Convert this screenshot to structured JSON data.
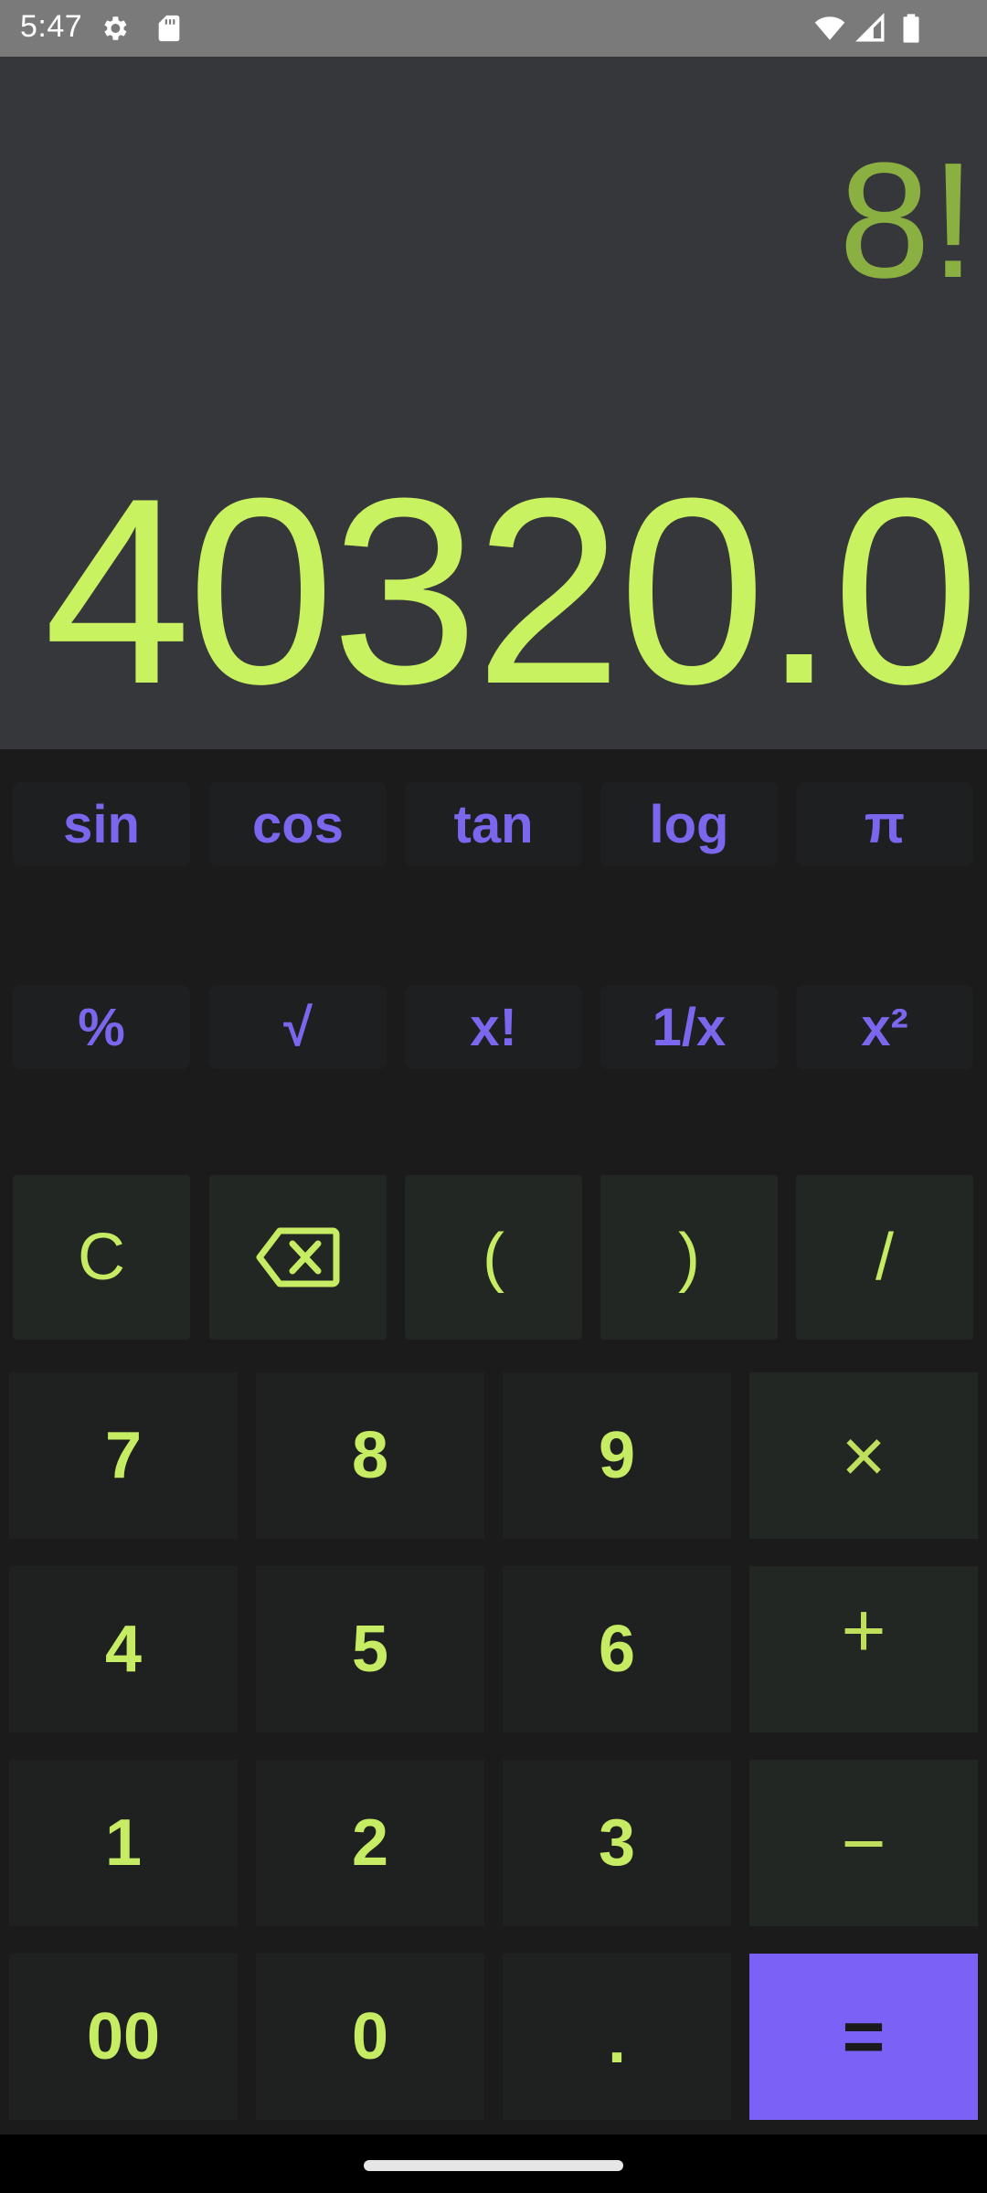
{
  "status_bar": {
    "time": "5:47",
    "left_icons": [
      "gear-icon",
      "sd-card-icon"
    ],
    "right_icons": [
      "wifi-icon",
      "cellular-signal-icon",
      "battery-icon"
    ]
  },
  "display": {
    "expression": "8!",
    "result": "40320.0"
  },
  "keypad": {
    "scientific_row_1": [
      "sin",
      "cos",
      "tan",
      "log",
      "π"
    ],
    "scientific_row_2": [
      "%",
      "√",
      "x!",
      "1/x",
      "x²"
    ],
    "utility_row": {
      "clear": "C",
      "backspace_icon": "backspace-icon",
      "open_paren": "(",
      "close_paren": ")",
      "divide": "/"
    },
    "digits": {
      "seven": "7",
      "eight": "8",
      "nine": "9",
      "four": "4",
      "five": "5",
      "six": "6",
      "one": "1",
      "two": "2",
      "three": "3",
      "double_zero": "00",
      "zero": "0",
      "decimal": "."
    },
    "operators": {
      "multiply": "×",
      "add": "+",
      "subtract": "−",
      "equals": "="
    }
  },
  "colors": {
    "accent_purple": "#7b61f6",
    "result_green": "#c9f260",
    "expression_green": "#8bb042",
    "display_bg": "#36373b",
    "keypad_bg": "#1b1b1c"
  }
}
